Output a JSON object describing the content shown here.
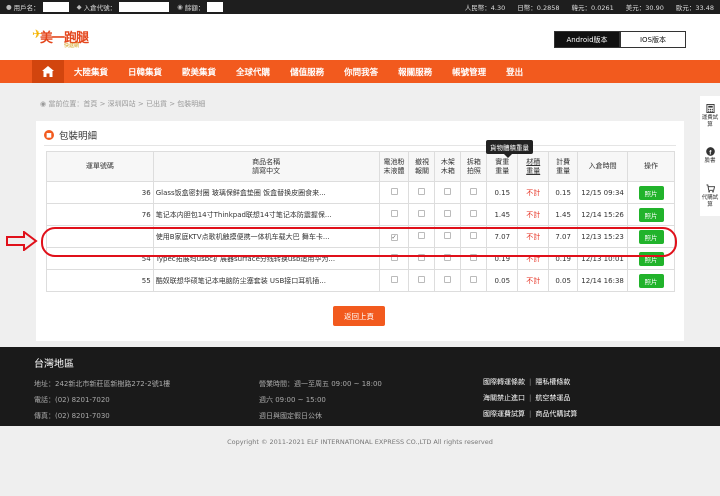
{
  "topbar": {
    "username_label": "用戶名：",
    "warehouse_code_label": "入倉代號：",
    "balance_label": "餘額：",
    "rates": [
      "人民幣：4.30",
      "日幣：0.2858",
      "韓元：0.0261",
      "美元：30.90",
      "歐元：33.48"
    ]
  },
  "logo": {
    "title": "美一跑腿",
    "subtitle": "快遞網"
  },
  "app_buttons": {
    "android": "Android版本",
    "ios": "IOS版本"
  },
  "nav": [
    "大陸集貨",
    "日韓集貨",
    "歐美集貨",
    "全球代購",
    "儲值服務",
    "你問我答",
    "報關服務",
    "帳號管理",
    "登出"
  ],
  "breadcrumb": "當前位置：首頁 > 深圳四站 > 已出貨 > 包裝明細",
  "panel_title": "包裝明細",
  "tooltip": "貨物體積重量",
  "table": {
    "headers": [
      [
        "運單號碼"
      ],
      [
        "商品名稱",
        "請寫中文"
      ],
      [
        "電池粉",
        "末液體"
      ],
      [
        "撤視",
        "報關"
      ],
      [
        "木架",
        "木箱"
      ],
      [
        "拆箱",
        "拍照"
      ],
      [
        "實重",
        "重量"
      ],
      [
        "材積",
        "重量"
      ],
      [
        "計費",
        "重量"
      ],
      [
        "入倉時間"
      ],
      [
        "操作"
      ]
    ],
    "rows": [
      {
        "no": "36",
        "name": "Glass饭盒密封圈 玻璃保鲜盒垫圈 饭盒替换皮圈食来...",
        "battery": false,
        "actual": "0.15",
        "volume": "不計",
        "charge": "0.15",
        "time": "12/15 09:34",
        "action": "照片"
      },
      {
        "no": "76",
        "name": "笔记本内胆包14寸Thinkpad联想14寸笔记本防震握保...",
        "battery": false,
        "actual": "1.45",
        "volume": "不計",
        "charge": "1.45",
        "time": "12/14 15:26",
        "action": "照片"
      },
      {
        "no": "",
        "name": "使用B家庭KTV点歌机触摸便携一体机车载大巴 舞车卡...",
        "battery": true,
        "actual": "7.07",
        "volume": "不計",
        "charge": "7.07",
        "time": "12/13 15:23",
        "action": "照片"
      },
      {
        "no": "54",
        "name": "Typec拓展坞usbc扩展器surface分线转换usb适用华为...",
        "battery": false,
        "actual": "0.19",
        "volume": "不計",
        "charge": "0.19",
        "time": "12/13 10:01",
        "action": "照片"
      },
      {
        "no": "55",
        "name": "酷奴联想华硕笔记本电脑防尘塞套装 USB接口耳机插...",
        "battery": false,
        "actual": "0.05",
        "volume": "不計",
        "charge": "0.05",
        "time": "12/14 16:38",
        "action": "照片"
      }
    ]
  },
  "back_button": "返回上頁",
  "side": [
    "運費試算",
    "臉書",
    "代購試算"
  ],
  "footer": {
    "region": "台灣地區",
    "address": "地址：242新北市新莊區新樹路272-2號1樓",
    "phone": "電話：(02) 8201-7020",
    "fax": "傳真：(02) 8201-7030",
    "hours1": "營業時間：週一至周五 09:00 ~ 18:00",
    "hours2": "週六 09:00 ~ 15:00",
    "hours3": "週日與國定假日公休",
    "links": [
      [
        "國際轉運條款",
        "隱私權條款"
      ],
      [
        "海關禁止進口",
        "航空禁運品"
      ],
      [
        "國際運費試算",
        "商品代購試算"
      ]
    ]
  },
  "copyright": "Copyright © 2011-2021 ELF INTERNATIONAL EXPRESS CO.,LTD All rights reserved",
  "colors": {
    "brand": "#f25a1e",
    "photo_button": "#21b32b",
    "highlight": "#e0101a",
    "not_counted": "#e52b1c"
  }
}
